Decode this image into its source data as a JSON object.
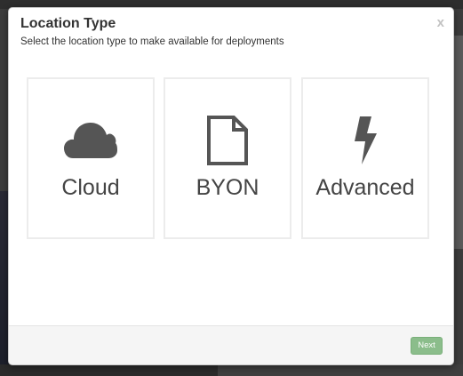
{
  "modal": {
    "title": "Location Type",
    "subtitle": "Select the location type to make available for deployments",
    "close_label": "x"
  },
  "options": [
    {
      "label": "Cloud",
      "icon": "cloud-icon"
    },
    {
      "label": "BYON",
      "icon": "file-icon"
    },
    {
      "label": "Advanced",
      "icon": "lightning-bolt-icon"
    }
  ],
  "footer": {
    "next_label": "Next"
  },
  "colors": {
    "icon": "#555555",
    "tile_border": "#ececec",
    "next_button": "#8bbd8b",
    "footer_bg": "#f5f5f5"
  }
}
